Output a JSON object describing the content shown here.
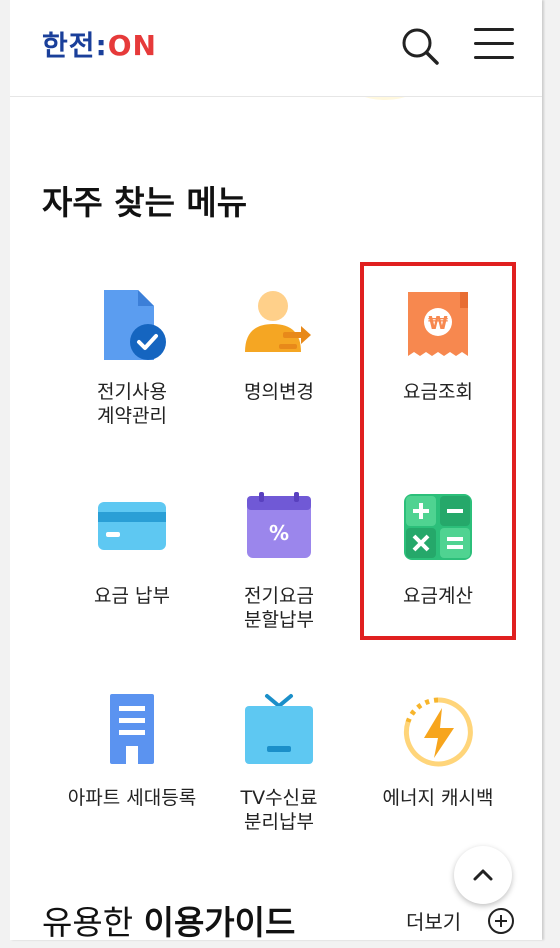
{
  "header": {
    "logo_text_prefix": "한전:",
    "logo_text_suffix": "ON"
  },
  "section": {
    "title": "자주 찾는 메뉴"
  },
  "menu_items": [
    {
      "label": "전기사용\n계약관리",
      "icon": "contract-check-icon"
    },
    {
      "label": "명의변경",
      "icon": "person-transfer-icon"
    },
    {
      "label": "요금조회",
      "icon": "won-receipt-icon"
    },
    {
      "label": "요금 납부",
      "icon": "card-icon"
    },
    {
      "label": "전기요금\n분할납부",
      "icon": "calendar-percent-icon"
    },
    {
      "label": "요금계산",
      "icon": "calculator-icon"
    },
    {
      "label": "아파트 세대등록",
      "icon": "apartment-icon"
    },
    {
      "label": "TV수신료\n분리납부",
      "icon": "tv-icon"
    },
    {
      "label": "에너지 캐시백",
      "icon": "energy-bolt-icon"
    }
  ],
  "guide": {
    "title_prefix": "유용한 ",
    "title_bold": "이용가이드",
    "more_label": "더보기"
  },
  "colors": {
    "highlight": "#e02020",
    "logo_blue": "#1a3f9a",
    "logo_red": "#e63a3a"
  }
}
